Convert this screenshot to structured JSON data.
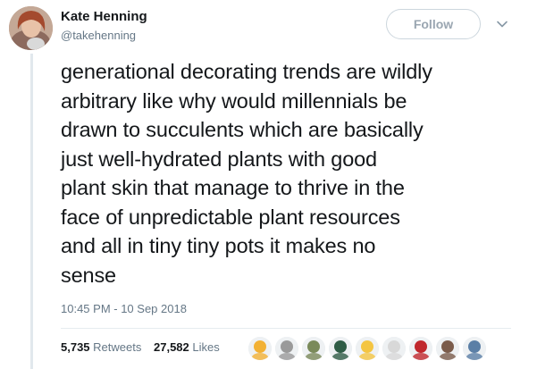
{
  "user": {
    "display_name": "Kate Henning",
    "handle": "@takehenning",
    "avatar_icon": "profile-photo-avatar"
  },
  "header": {
    "follow_label": "Follow",
    "caret_icon": "chevron-down-icon"
  },
  "tweet": {
    "lines": [
      "generational decorating trends are wildly",
      "arbitrary like why would millennials be",
      "drawn to succulents which are basically",
      "just well-hydrated plants with good",
      "plant skin that manage to thrive in the",
      "face of unpredictable plant resources",
      "and all in tiny tiny pots it makes no",
      "sense"
    ],
    "timestamp": "10:45 PM - 10 Sep 2018"
  },
  "stats": {
    "retweets_count": "5,735",
    "retweets_label": "Retweets",
    "likes_count": "27,582",
    "likes_label": "Likes"
  },
  "likers": [
    {
      "icon": "liker-avatar-icon",
      "color": "#f2b134"
    },
    {
      "icon": "liker-avatar-icon",
      "color": "#9a9a9a"
    },
    {
      "icon": "liker-avatar-icon",
      "color": "#7a8a5a"
    },
    {
      "icon": "liker-avatar-icon",
      "color": "#2f5d46"
    },
    {
      "icon": "liker-avatar-icon",
      "color": "#f4c542"
    },
    {
      "icon": "liker-avatar-icon",
      "color": "#d8d8d8"
    },
    {
      "icon": "liker-avatar-icon",
      "color": "#c0282d"
    },
    {
      "icon": "liker-avatar-icon",
      "color": "#7b5c4b"
    },
    {
      "icon": "liker-avatar-icon",
      "color": "#5b7fa6"
    }
  ],
  "colors": {
    "text_primary": "#14171a",
    "text_secondary": "#657786",
    "border": "#ccd6dd",
    "follow_text": "#9aa6b1"
  }
}
